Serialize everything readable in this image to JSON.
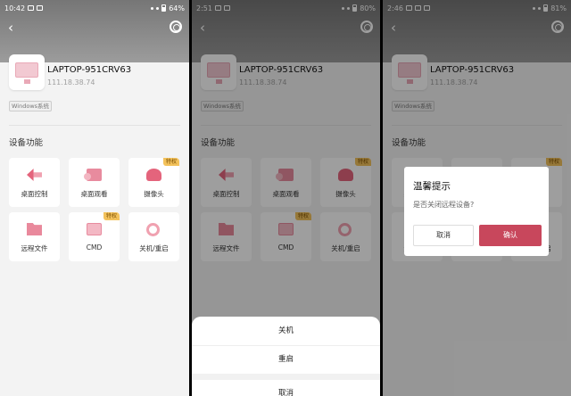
{
  "device": {
    "name": "LAPTOP-951CRV63",
    "ip": "111.18.38.74",
    "os_tag": "Windows系统"
  },
  "section_title": "设备功能",
  "features": [
    {
      "label": "桌面控制",
      "icon": "arrow-left-icon",
      "badge": ""
    },
    {
      "label": "桌面观看",
      "icon": "screen-view-icon",
      "badge": ""
    },
    {
      "label": "摄像头",
      "icon": "camera-icon",
      "badge": "特权"
    },
    {
      "label": "远程文件",
      "icon": "folder-icon",
      "badge": ""
    },
    {
      "label": "CMD",
      "icon": "cmd-icon",
      "badge": "特权"
    },
    {
      "label": "关机/重启",
      "icon": "power-icon",
      "badge": ""
    }
  ],
  "status_bars": [
    {
      "time": "10:42",
      "battery": "64%"
    },
    {
      "time": "2:51",
      "battery": "80%"
    },
    {
      "time": "2:46",
      "battery": "81%"
    }
  ],
  "sheet": {
    "shutdown": "关机",
    "restart": "重启",
    "cancel": "取消"
  },
  "dialog": {
    "title": "温馨提示",
    "message": "是否关闭远程设备?",
    "cancel": "取消",
    "confirm": "确认"
  },
  "colors": {
    "accent": "#c8475c",
    "badge": "#f3c25c",
    "header_gray": "#8a8a8a"
  }
}
